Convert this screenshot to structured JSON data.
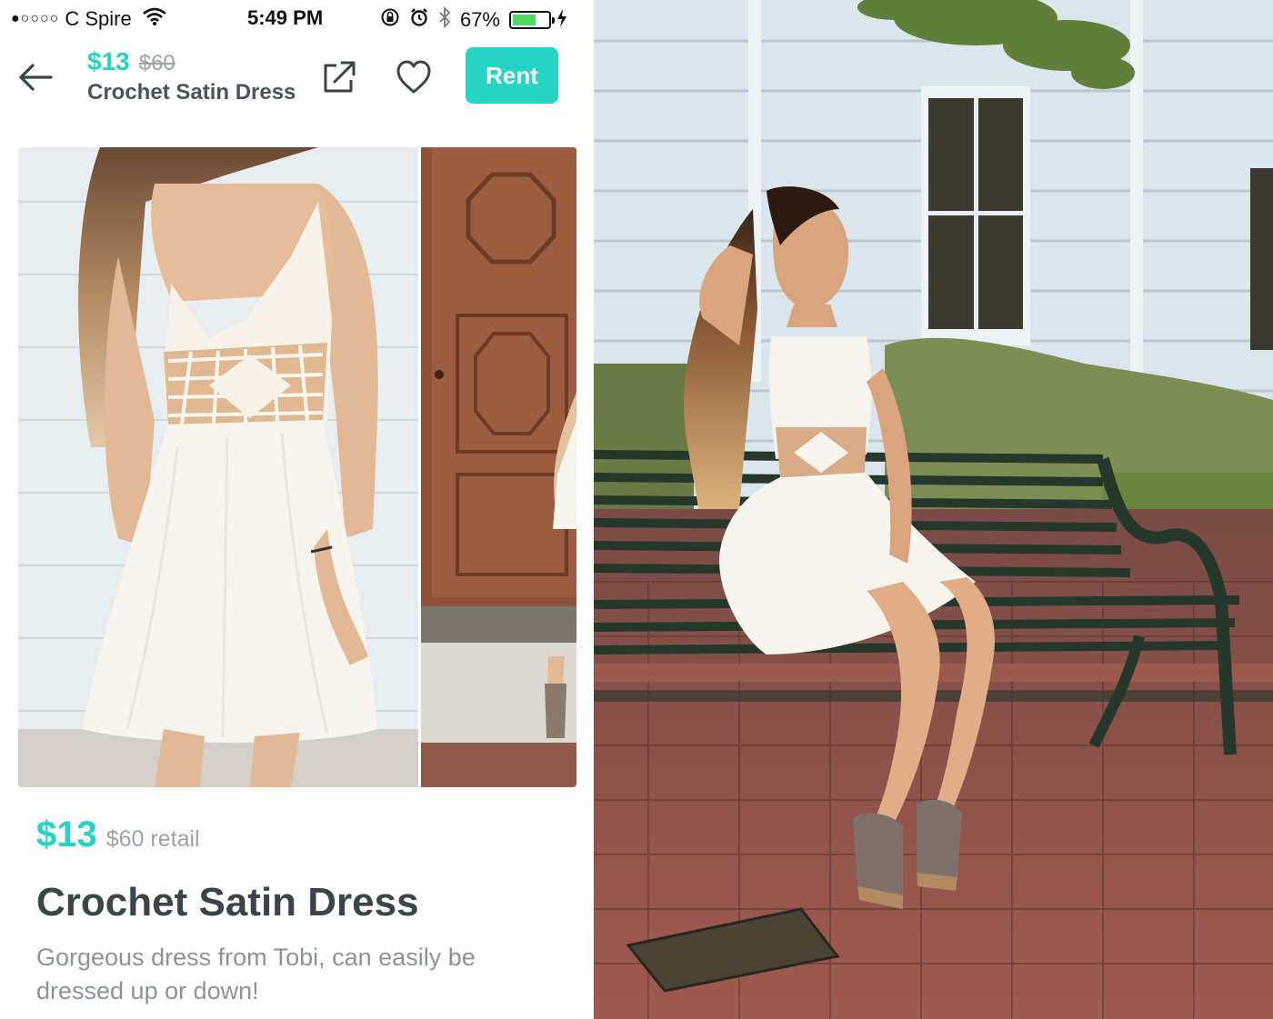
{
  "status_bar": {
    "signal": "●○○○○",
    "carrier": "C Spire",
    "time": "5:49 PM",
    "battery_percent": "67%",
    "battery_level": 0.67,
    "icons": [
      "wifi-icon",
      "orientation-lock-icon",
      "alarm-icon",
      "bluetooth-icon",
      "battery-icon",
      "charging-icon"
    ]
  },
  "nav": {
    "price": "$13",
    "retail": "$60",
    "title": "Crochet Satin Dress",
    "rent_label": "Rent",
    "icons": [
      "back-arrow-icon",
      "share-icon",
      "heart-icon"
    ]
  },
  "product": {
    "price": "$13",
    "retail": "$60 retail",
    "title": "Crochet Satin Dress",
    "description": "Gorgeous dress from Tobi, can easily be dressed up or down!"
  },
  "colors": {
    "accent": "#26d3c4",
    "muted": "#9aa4a8",
    "title_text": "#3b4449",
    "battery": "#4cd964"
  }
}
